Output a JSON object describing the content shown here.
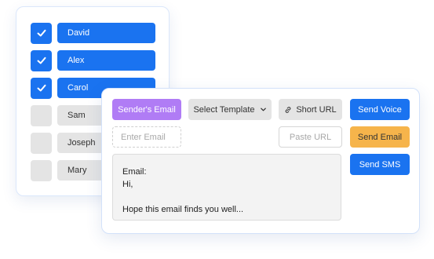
{
  "contacts": [
    {
      "name": "David",
      "checked": true
    },
    {
      "name": "Alex",
      "checked": true
    },
    {
      "name": "Carol",
      "checked": true
    },
    {
      "name": "Sam",
      "checked": false
    },
    {
      "name": "Joseph",
      "checked": false
    },
    {
      "name": "Mary",
      "checked": false
    }
  ],
  "toolbar": {
    "sender_email_label": "Sender's Email",
    "select_template_label": "Select Template",
    "short_url_label": "Short URL",
    "send_voice_label": "Send Voice"
  },
  "fields": {
    "enter_email_placeholder": "Enter Email",
    "paste_url_placeholder": "Paste URL"
  },
  "actions": {
    "send_email_label": "Send Email",
    "send_sms_label": "Send SMS"
  },
  "message": {
    "line1": "Email:",
    "line2": "Hi,",
    "line3": "Hope this email finds you well..."
  },
  "colors": {
    "primary": "#1a73f0",
    "purple": "#b07cf5",
    "orange": "#f6b44b",
    "gray": "#e4e4e4"
  },
  "icons": {
    "check": "check-icon",
    "link": "link-icon",
    "chevron": "chevron-down-icon"
  }
}
